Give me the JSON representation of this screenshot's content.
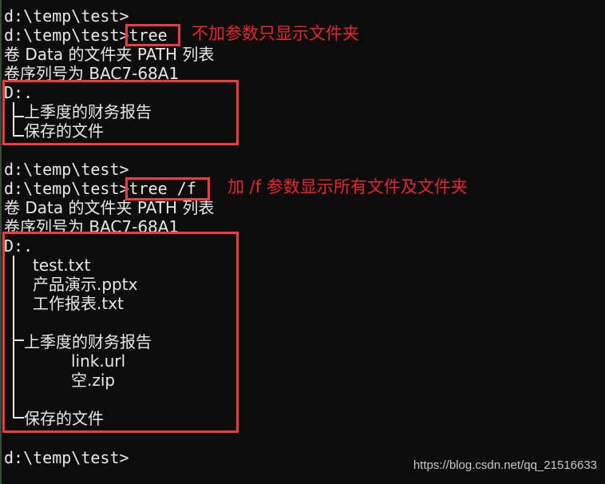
{
  "terminal": {
    "prompt": "d:\\temp\\test>",
    "session1": {
      "prompt_line": "d:\\temp\\test>",
      "command_prompt": "d:\\temp\\test>",
      "command": "tree",
      "annotation": "不加参数只显示文件夹",
      "header_line1": "卷 Data 的文件夹 PATH 列表",
      "header_line2": "卷序列号为 BAC7-68A1",
      "root": "D:.",
      "folders": [
        "上季度的财务报告",
        "保存的文件"
      ]
    },
    "session2": {
      "prompt_line": "d:\\temp\\test>",
      "command_prompt": "d:\\temp\\test>",
      "command": "tree /f",
      "annotation": "加 /f 参数显示所有文件及文件夹",
      "header_line1": "卷 Data 的文件夹 PATH 列表",
      "header_line2": "卷序列号为 BAC7-68A1",
      "root": "D:.",
      "root_files": [
        "test.txt",
        "产品演示.pptx",
        "工作报表.txt"
      ],
      "folder1": {
        "name": "上季度的财务报告",
        "files": [
          "link.url",
          "空.zip"
        ]
      },
      "folder2": {
        "name": "保存的文件"
      }
    },
    "final_prompt": "d:\\temp\\test>"
  },
  "watermark": "https://blog.csdn.net/qq_21516633",
  "colors": {
    "background": "#0c0c0c",
    "text": "#e8e8e8",
    "annotation": "#e8262d",
    "highlight_box": "#ee3b3b"
  }
}
